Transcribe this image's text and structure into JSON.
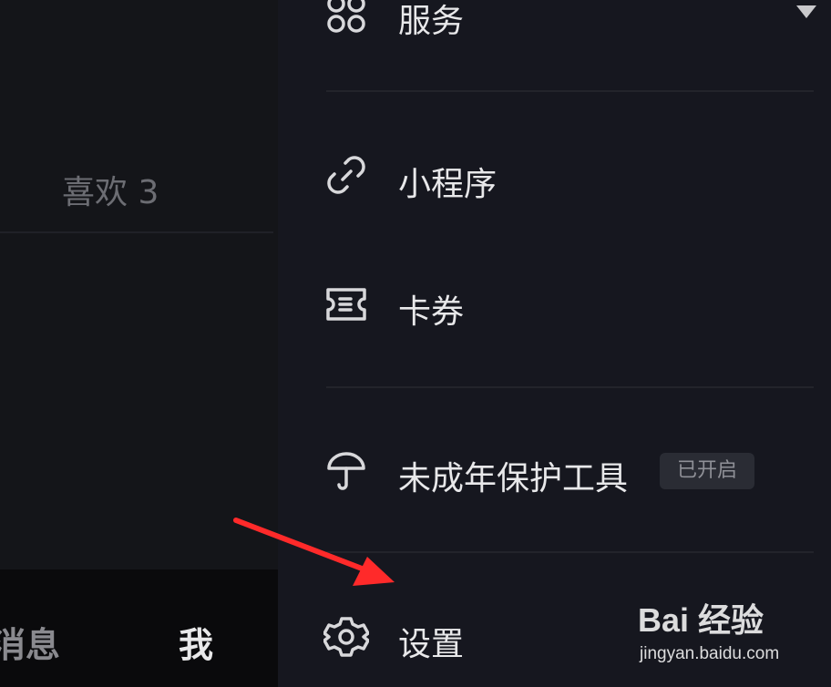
{
  "left_page": {
    "likes_tab": "喜欢 3"
  },
  "bottom_nav": {
    "messages": "消息",
    "me": "我"
  },
  "drawer": {
    "items": [
      {
        "label": "服务",
        "icon": "grid-icon"
      },
      {
        "label": "小程序",
        "icon": "link-icon"
      },
      {
        "label": "卡券",
        "icon": "ticket-icon"
      },
      {
        "label": "未成年保护工具",
        "icon": "umbrella-icon",
        "badge": "已开启"
      },
      {
        "label": "设置",
        "icon": "gear-icon"
      }
    ]
  },
  "watermark": {
    "main": "Bai 经验",
    "sub": "jingyan.baidu.com"
  },
  "colors": {
    "background": "#16171f",
    "text": "#e8e8ea",
    "annotation_arrow": "#ff2a2a"
  }
}
